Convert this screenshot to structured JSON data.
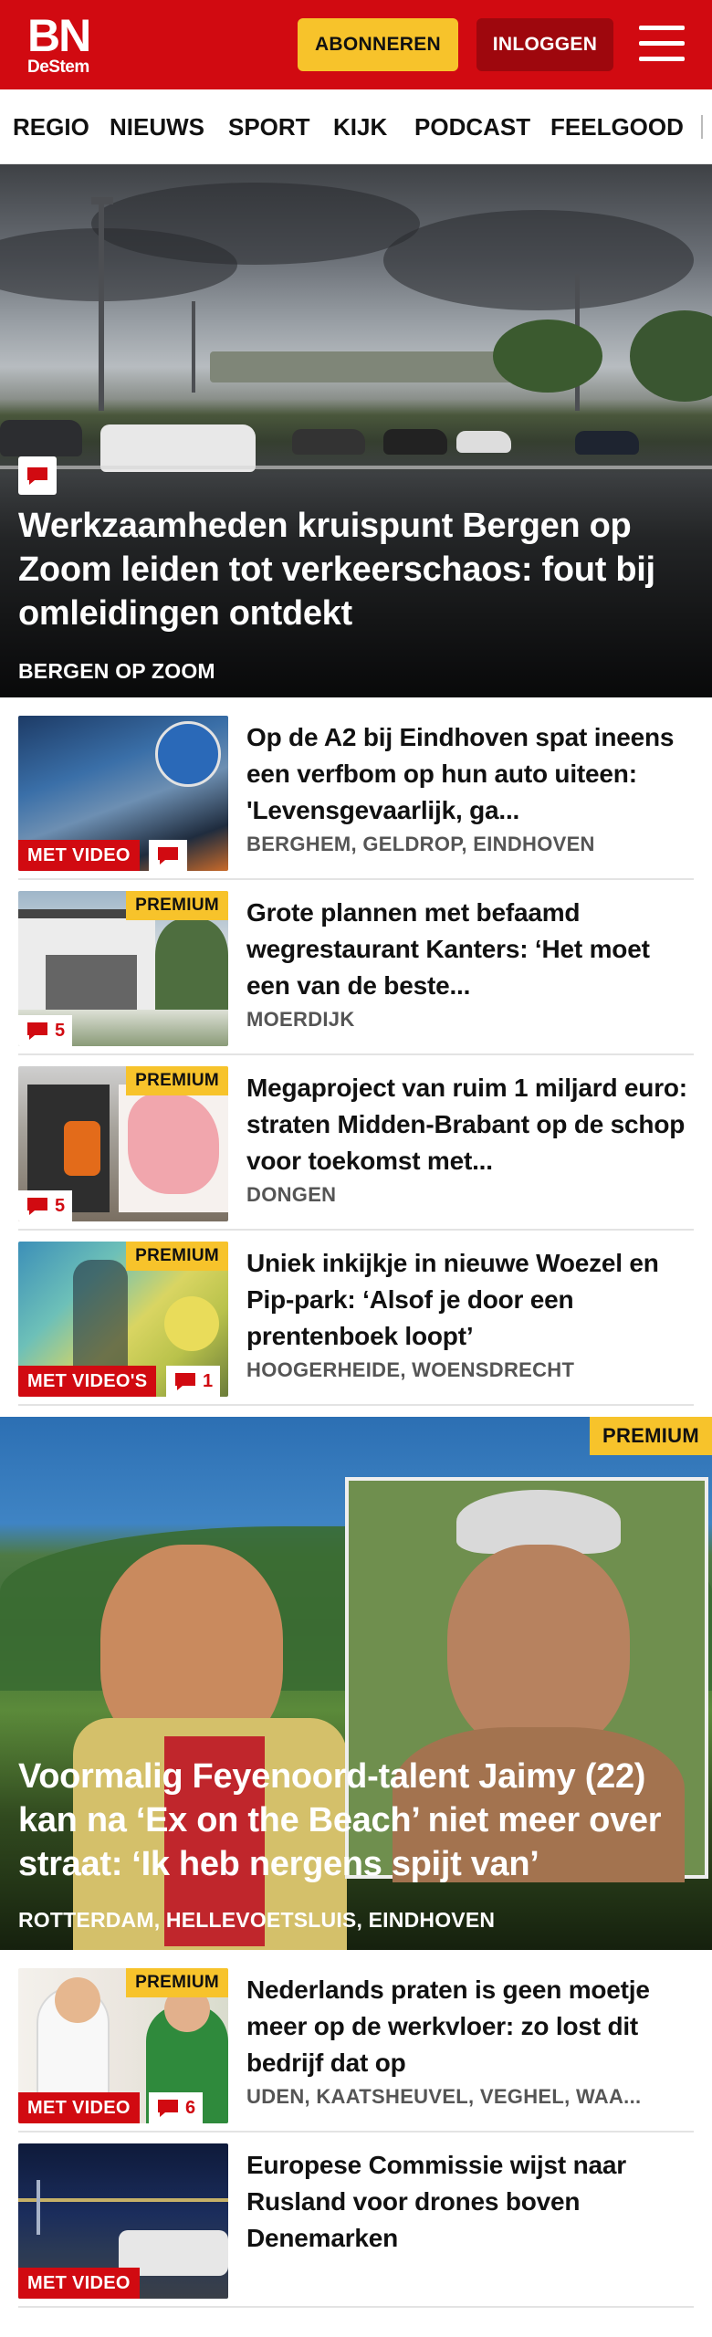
{
  "header": {
    "logo_main": "BN",
    "logo_sub": "DeStem",
    "subscribe_label": "ABONNEREN",
    "login_label": "INLOGGEN",
    "menu_icon": "hamburger-icon",
    "brand_color": "#d10a11",
    "accent_color": "#f7c32b"
  },
  "nav": {
    "items": [
      {
        "label": "REGIO"
      },
      {
        "label": "NIEUWS"
      },
      {
        "label": "SPORT"
      },
      {
        "label": "KIJK"
      },
      {
        "label": "PODCAST"
      },
      {
        "label": "FEELGOOD"
      }
    ]
  },
  "hero": {
    "title": "Werkzaamheden kruispunt Bergen op Zoom leiden tot verkeerschaos: fout bij omleidingen ontdekt",
    "location": "BERGEN OP ZOOM",
    "icon": "comment-icon"
  },
  "articles": [
    {
      "title": "Op de A2 bij Eindhoven spat ineens een verfbom op hun auto uiteen: 'Levensgevaarlijk, ga...",
      "location": "BERGHEM, GELDROP, EINDHOVEN",
      "video_label": "MET VIDEO",
      "comments": "",
      "premium": ""
    },
    {
      "title": "Grote plannen met befaamd wegrestaurant Kanters: ‘Het moet een van de beste...",
      "location": "MOERDIJK",
      "video_label": "",
      "comments": "5",
      "premium": "PREMIUM"
    },
    {
      "title": "Megaproject van ruim 1 miljard euro: straten Midden-Brabant op de schop voor toekomst met...",
      "location": "DONGEN",
      "video_label": "",
      "comments": "5",
      "premium": "PREMIUM"
    },
    {
      "title": "Uniek inkijkje in nieuwe Woezel en Pip-park: ‘Alsof je door een prentenboek loopt’",
      "location": "HOOGERHEIDE, WOENSDRECHT",
      "video_label": "MET VIDEO'S",
      "comments": "1",
      "premium": "PREMIUM"
    }
  ],
  "hero2": {
    "premium": "PREMIUM",
    "title": "Voormalig Feyenoord-talent Jaimy (22) kan na ‘Ex on the Beach’ niet meer over straat: ‘Ik heb nergens spijt van’",
    "location": "ROTTERDAM, HELLEVOETSLUIS, EINDHOVEN"
  },
  "articles2": [
    {
      "title": "Nederlands praten is geen moetje meer op de werkvloer: zo lost dit bedrijf dat op",
      "location": "UDEN, KAATSHEUVEL, VEGHEL, WAA...",
      "video_label": "MET VIDEO",
      "comments": "6",
      "premium": "PREMIUM"
    },
    {
      "title": "Europese Commissie wijst naar Rusland voor drones boven Denemarken",
      "location": "",
      "video_label": "MET VIDEO",
      "comments": "",
      "premium": ""
    }
  ]
}
